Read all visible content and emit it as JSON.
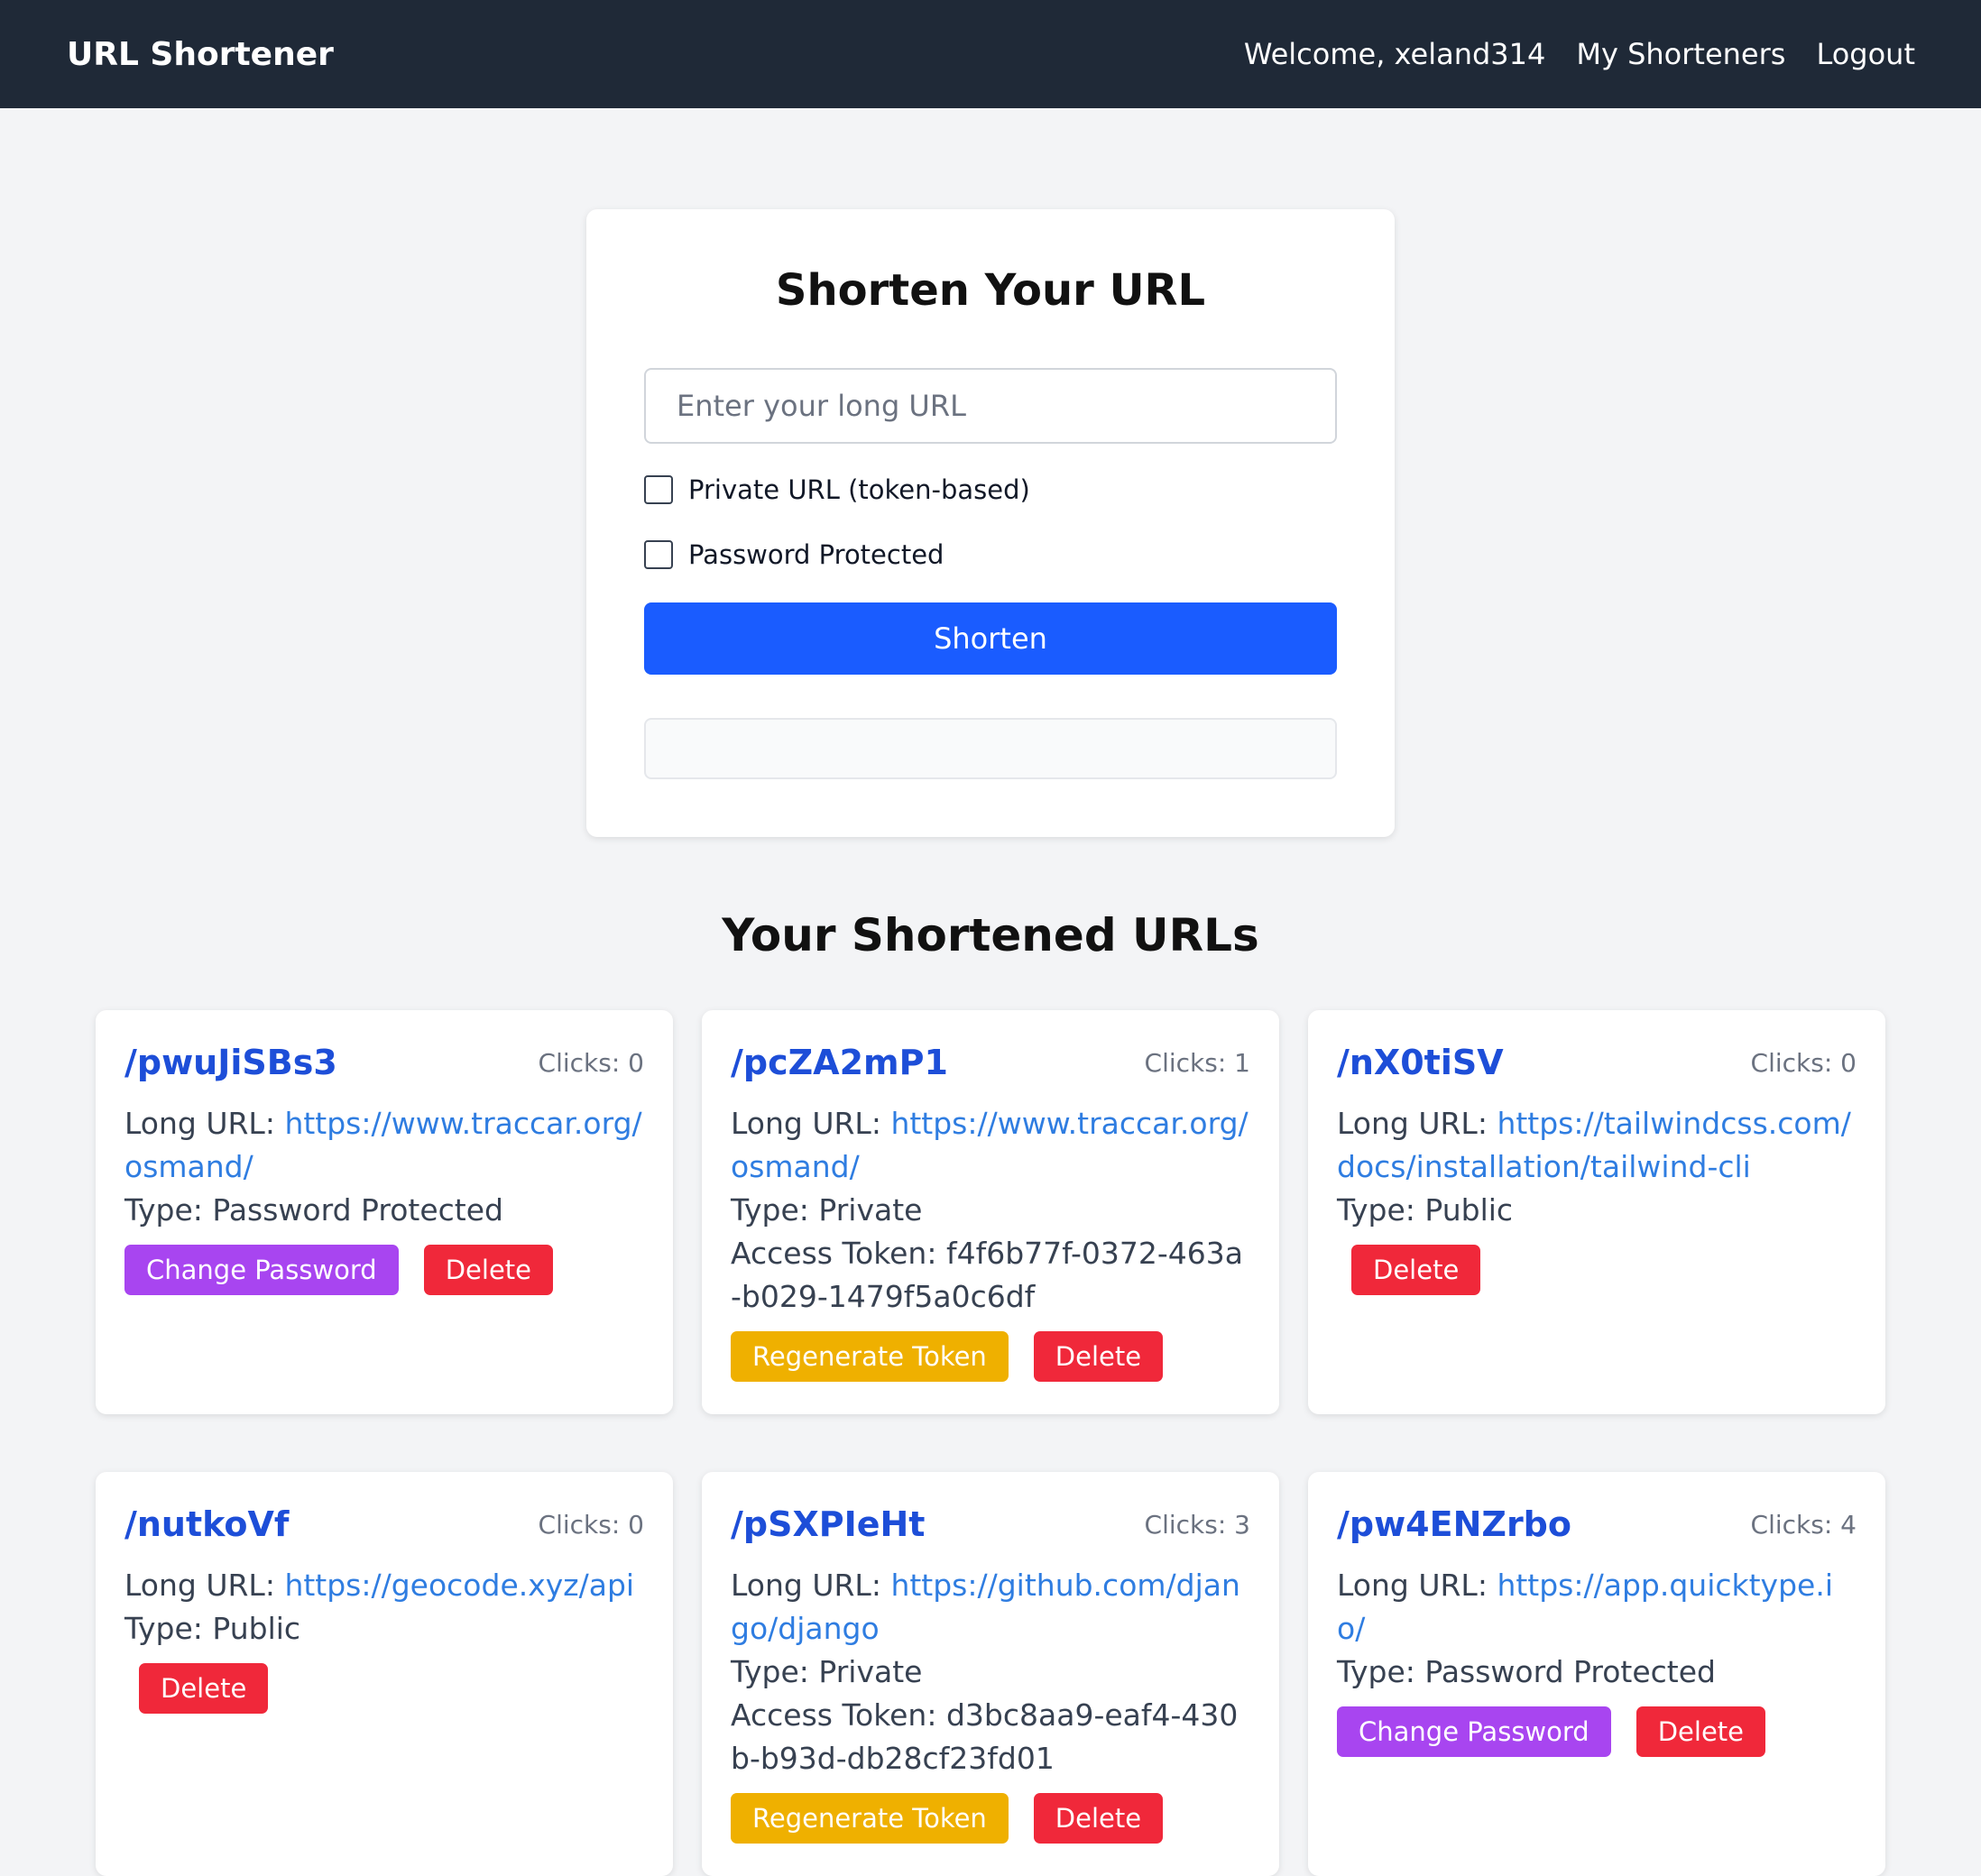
{
  "nav": {
    "brand": "URL Shortener",
    "welcome": "Welcome, xeland314",
    "my_shorteners": "My Shorteners",
    "logout": "Logout"
  },
  "form": {
    "title": "Shorten Your URL",
    "url_placeholder": "Enter your long URL",
    "url_value": "",
    "private_label": "Private URL (token-based)",
    "private_checked": false,
    "password_label": "Password Protected",
    "password_checked": false,
    "submit_label": "Shorten",
    "result_text": ""
  },
  "list": {
    "title": "Your Shortened URLs",
    "long_url_label": "Long URL: ",
    "type_label": "Type: ",
    "token_label": "Access Token: ",
    "clicks_label": "Clicks: ",
    "change_password_label": "Change Password",
    "regenerate_token_label": "Regenerate Token",
    "delete_label": "Delete",
    "items": [
      {
        "code": "/pwuJiSBs3",
        "clicks": "0",
        "long_url": "https://www.traccar.org/osmand/",
        "type": "Password Protected",
        "token": ""
      },
      {
        "code": "/pcZA2mP1",
        "clicks": "1",
        "long_url": "https://www.traccar.org/osmand/",
        "type": "Private",
        "token": "f4f6b77f-0372-463a-b029-1479f5a0c6df"
      },
      {
        "code": "/nX0tiSV",
        "clicks": "0",
        "long_url": "https://tailwindcss.com/docs/installation/tailwind-cli",
        "type": "Public",
        "token": ""
      },
      {
        "code": "/nutkoVf",
        "clicks": "0",
        "long_url": "https://geocode.xyz/api",
        "type": "Public",
        "token": ""
      },
      {
        "code": "/pSXPIeHt",
        "clicks": "3",
        "long_url": "https://github.com/django/django",
        "type": "Private",
        "token": "d3bc8aa9-eaf4-430b-b93d-db28cf23fd01"
      },
      {
        "code": "/pw4ENZrbo",
        "clicks": "4",
        "long_url": "https://app.quicktype.io/",
        "type": "Password Protected",
        "token": ""
      }
    ]
  },
  "colors": {
    "navbar": "#1f2937",
    "primary": "#1a5cff",
    "link": "#2f7de1",
    "code": "#1d4ed8",
    "change_password": "#a845f0",
    "regenerate": "#efb000",
    "delete": "#f0283a"
  }
}
